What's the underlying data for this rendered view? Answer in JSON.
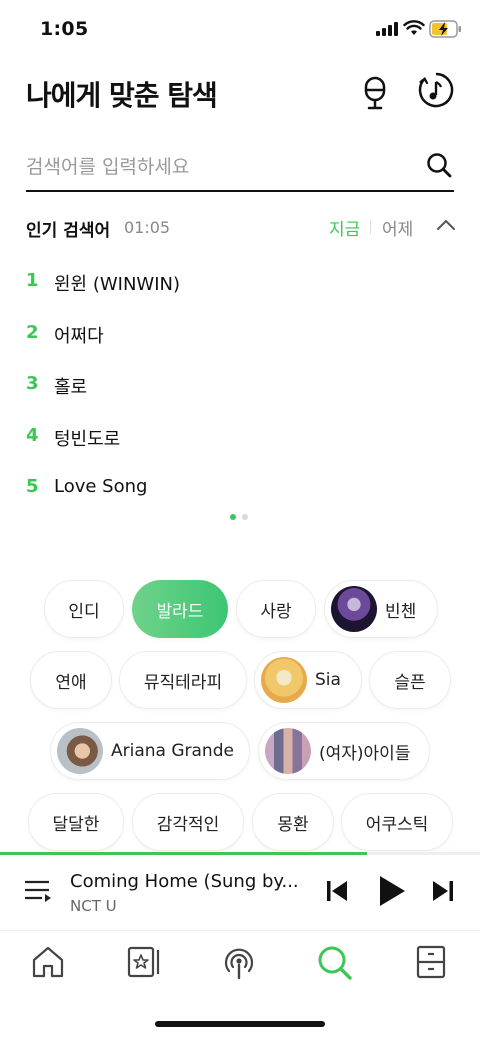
{
  "status": {
    "time": "1:05"
  },
  "header": {
    "title": "나에게 맞춘 탐색"
  },
  "search": {
    "placeholder": "검색어를 입력하세요"
  },
  "popular": {
    "title": "인기 검색어",
    "time": "01:05",
    "tab_now": "지금",
    "tab_yesterday": "어제",
    "items": [
      {
        "rank": "1",
        "term": "윈윈 (WINWIN)"
      },
      {
        "rank": "2",
        "term": "어쩌다"
      },
      {
        "rank": "3",
        "term": "홀로"
      },
      {
        "rank": "4",
        "term": "텅빈도로"
      },
      {
        "rank": "5",
        "term": "Love Song"
      }
    ]
  },
  "chips": [
    {
      "label": "인디"
    },
    {
      "label": "발라드",
      "active": true
    },
    {
      "label": "사랑"
    },
    {
      "label": "빈첸"
    },
    {
      "label": "연애"
    },
    {
      "label": "뮤직테라피"
    },
    {
      "label": "Sia"
    },
    {
      "label": "슬픈"
    },
    {
      "label": "Ariana Grande"
    },
    {
      "label": "(여자)아이들"
    },
    {
      "label": "달달한"
    },
    {
      "label": "감각적인"
    },
    {
      "label": "몽환"
    },
    {
      "label": "어쿠스틱"
    }
  ],
  "player": {
    "song": "Coming Home (Sung by...",
    "artist": "NCT U",
    "progress": 0.765
  },
  "colors": {
    "accent": "#3cc654"
  },
  "icons": {
    "header": [
      "mic-icon",
      "music-history-icon"
    ],
    "search": "search-icon",
    "player": [
      "playlist-icon",
      "previous-icon",
      "play-icon",
      "next-icon"
    ],
    "tabs": [
      "home-icon",
      "library-icon",
      "podcast-icon",
      "search-icon",
      "storage-icon"
    ]
  }
}
